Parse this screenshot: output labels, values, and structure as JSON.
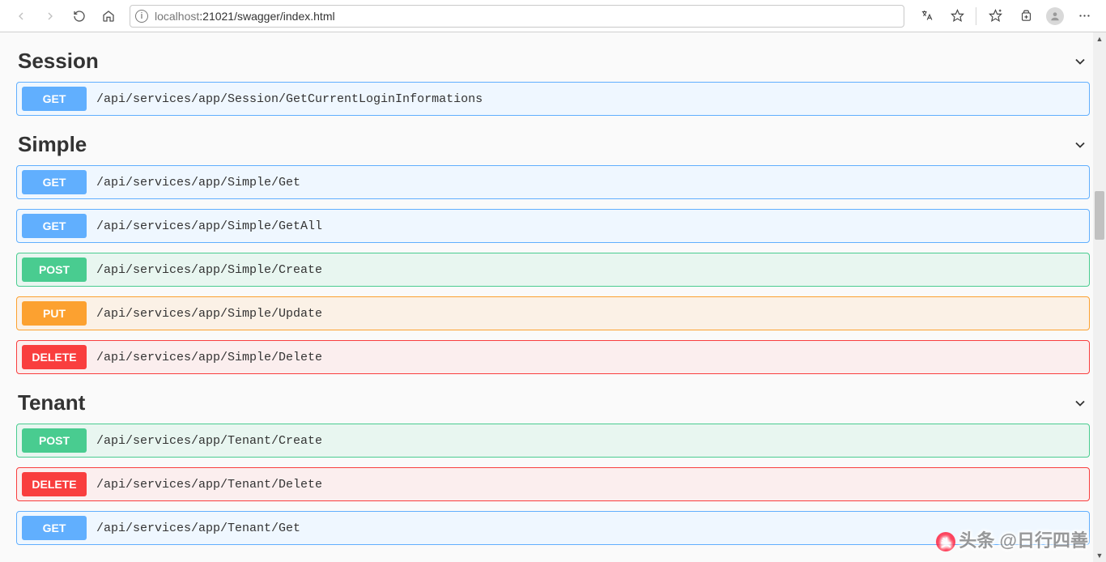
{
  "url": {
    "host_dim": "localhost",
    "rest": ":21021/swagger/index.html"
  },
  "methods": {
    "get": "GET",
    "post": "POST",
    "put": "PUT",
    "delete": "DELETE"
  },
  "tags": [
    {
      "name": "Session",
      "ops": [
        {
          "method": "get",
          "path": "/api/services/app/Session/GetCurrentLoginInformations"
        }
      ]
    },
    {
      "name": "Simple",
      "ops": [
        {
          "method": "get",
          "path": "/api/services/app/Simple/Get"
        },
        {
          "method": "get",
          "path": "/api/services/app/Simple/GetAll"
        },
        {
          "method": "post",
          "path": "/api/services/app/Simple/Create"
        },
        {
          "method": "put",
          "path": "/api/services/app/Simple/Update"
        },
        {
          "method": "delete",
          "path": "/api/services/app/Simple/Delete"
        }
      ]
    },
    {
      "name": "Tenant",
      "ops": [
        {
          "method": "post",
          "path": "/api/services/app/Tenant/Create"
        },
        {
          "method": "delete",
          "path": "/api/services/app/Tenant/Delete"
        },
        {
          "method": "get",
          "path": "/api/services/app/Tenant/Get"
        }
      ]
    }
  ],
  "watermark": "头条 @日行四善"
}
